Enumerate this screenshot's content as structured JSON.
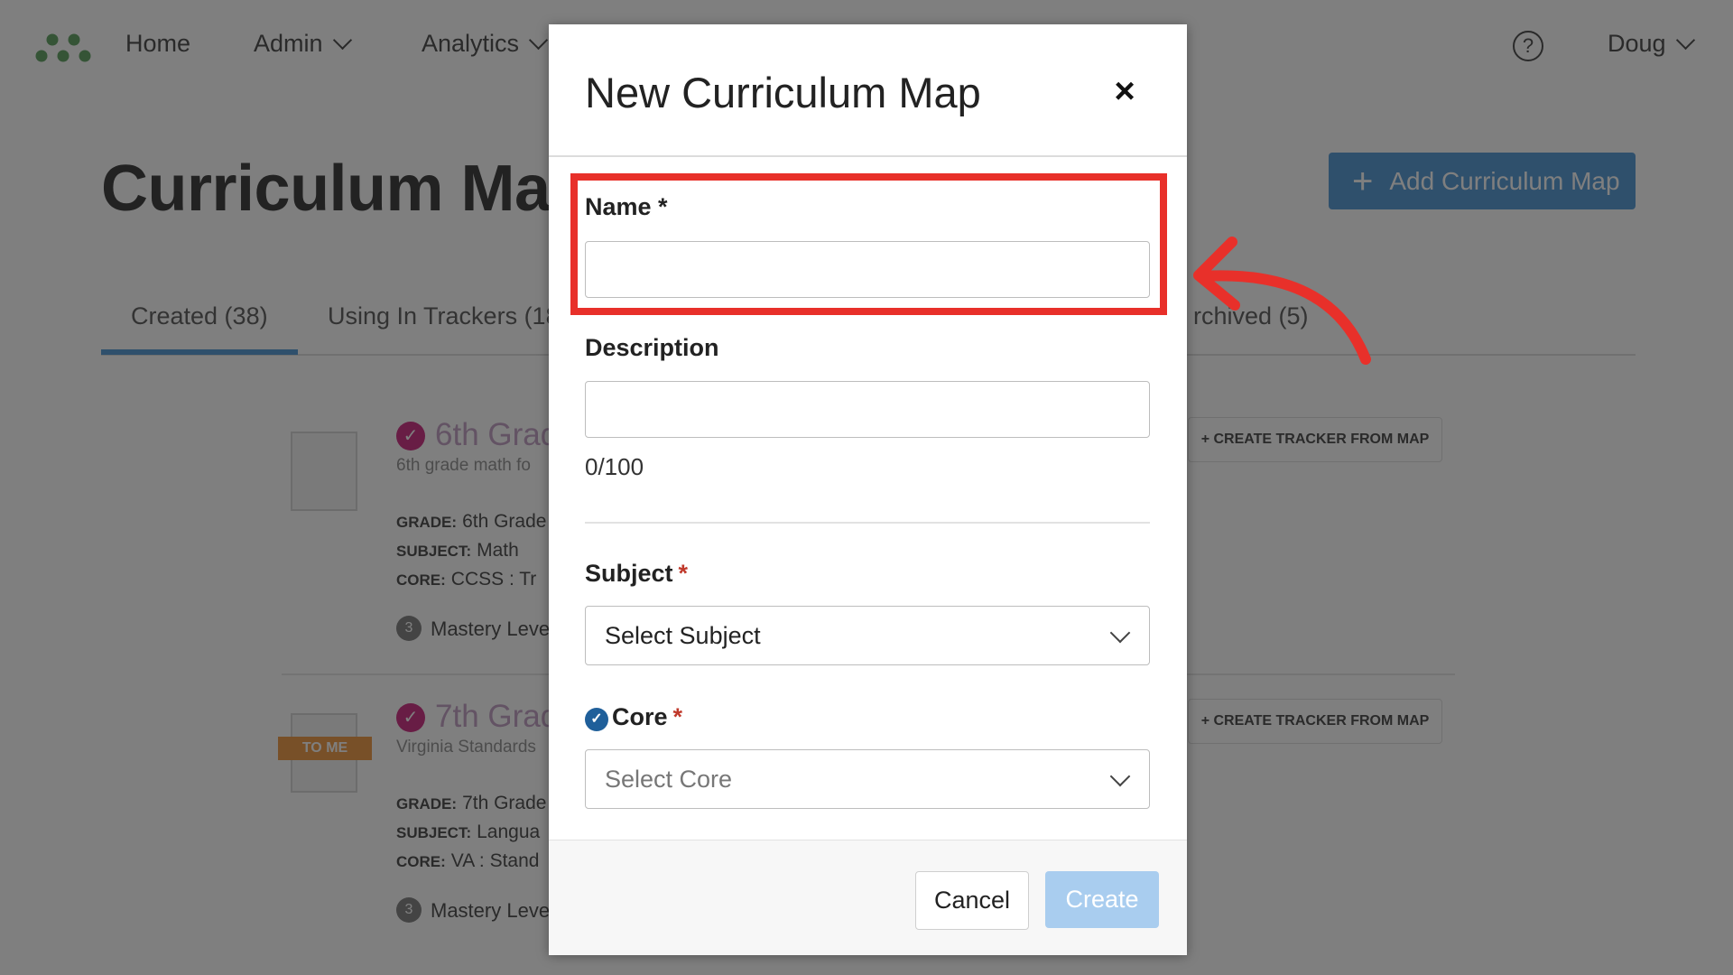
{
  "nav": {
    "home": "Home",
    "admin": "Admin",
    "analytics": "Analytics",
    "help_icon": "?",
    "user": "Doug"
  },
  "header": {
    "title": "Curriculum Maps",
    "add_button": "Add Curriculum Map"
  },
  "tabs": [
    {
      "label": "Created (38)"
    },
    {
      "label": "Using In Trackers (18"
    },
    {
      "label": "rchived (5)"
    }
  ],
  "cards": [
    {
      "title": "6th Grad",
      "subtitle": "6th grade math fo",
      "grade_label": "GRADE:",
      "grade": "6th Grade",
      "subject_label": "SUBJECT:",
      "subject": "Math",
      "core_label": "CORE:",
      "core": "CCSS : Tr",
      "mastery_count": "3",
      "mastery_label": "Mastery Leve",
      "tracker_button": "+ CREATE TRACKER FROM MAP"
    },
    {
      "title": "7th Grad",
      "subtitle": "Virginia Standards",
      "badge": "TO ME",
      "grade_label": "GRADE:",
      "grade": "7th Grade",
      "subject_label": "SUBJECT:",
      "subject": "Langua",
      "core_label": "CORE:",
      "core": "VA : Stand",
      "mastery_count": "3",
      "mastery_label": "Mastery Leve",
      "tracker_button": "+ CREATE TRACKER FROM MAP"
    }
  ],
  "modal": {
    "title": "New Curriculum Map",
    "close_icon": "×",
    "name_label": "Name *",
    "name_value": "",
    "description_label": "Description",
    "description_value": "",
    "counter": "0/100",
    "subject_label": "Subject",
    "subject_required": "*",
    "subject_select": "Select Subject",
    "core_label": "Core",
    "core_required": "*",
    "core_select": "Select Core",
    "cancel": "Cancel",
    "create": "Create"
  },
  "colors": {
    "accent": "#5fa0d8",
    "highlight": "#e8302a",
    "required": "#c0392b",
    "core_icon": "#1f5f9a"
  }
}
